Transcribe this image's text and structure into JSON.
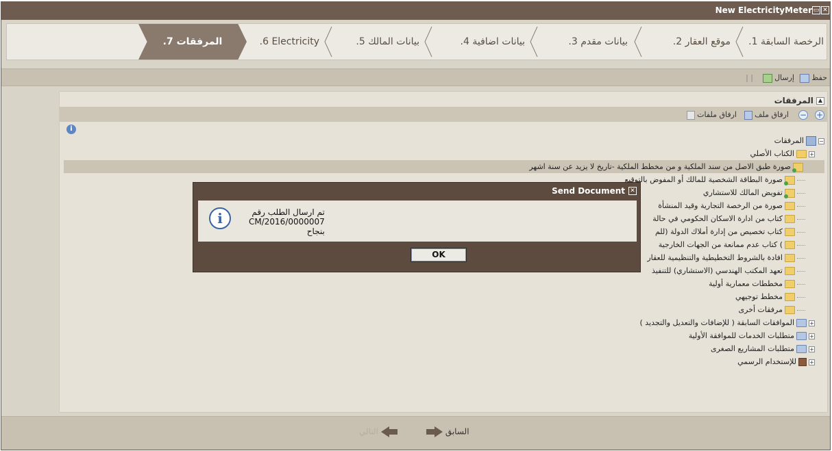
{
  "window": {
    "title": "New ElectricityMeter"
  },
  "wizard": {
    "steps": [
      {
        "label": ".1 الرخصة السابقة"
      },
      {
        "label": ".2 موقع العقار"
      },
      {
        "label": ".3 بيانات مقدم"
      },
      {
        "label": ".4 بيانات اضافية"
      },
      {
        "label": ".5 بيانات المالك"
      },
      {
        "label": ".6 Electricity"
      },
      {
        "label": ".7 المرفقات"
      }
    ],
    "active_step": 7
  },
  "toolbar": {
    "save_label": "حفظ",
    "send_label": "إرسال"
  },
  "attachments": {
    "header": "المرفقات",
    "add_file_label": "ارفاق ملف",
    "add_files_label": "ارفاق ملفات",
    "tree": {
      "root": "المرفقات",
      "nodes": [
        {
          "label": "الكتاب الأصلي"
        },
        {
          "label": "صورة طبق الاصل من سند الملكية و من مخطط الملكية -تاريخ لا يزيد عن سنة اشهر"
        },
        {
          "label": "صورة البطاقة الشخصية للمالك أو المفوض بالتوقيع"
        },
        {
          "label": "تفويض المالك للاستشاري"
        },
        {
          "label": "صورة من الرخصة التجارية وقيد المنشأة"
        },
        {
          "label": "كتاب من ادارة الاسكان الحكومي في حالة"
        },
        {
          "label": "كتاب تخصيص من إدارة أملاك الدولة (للم"
        },
        {
          "label": "كتاب عدم ممانعة من الجهات الخارجية ("
        },
        {
          "label": "افادة بالشروط التخطيطية والتنظيمية للعقار"
        },
        {
          "label": "تعهد المكتب الهندسي (الاستشاري) للتنفيذ"
        },
        {
          "label": "مخططات معمارية أولية"
        },
        {
          "label": "مخطط توجيهي"
        },
        {
          "label": "مرفقات أخرى"
        },
        {
          "label": "الموافقات السابقة ( للإضافات والتعديل والتجديد )"
        },
        {
          "label": "متطلبات الخدمات للموافقة الأولية"
        },
        {
          "label": "متطلبات المشاريع الصغرى"
        },
        {
          "label": "للإستخدام الرسمي"
        }
      ]
    }
  },
  "footer": {
    "prev_label": "السابق",
    "next_label": "التالي"
  },
  "dialog": {
    "title": "Send Document",
    "message_line1": "تم ارسال الطلب رقم",
    "message_line2": "CM/2016/0000007",
    "message_line3": "بنجاح",
    "ok_label": "OK"
  }
}
